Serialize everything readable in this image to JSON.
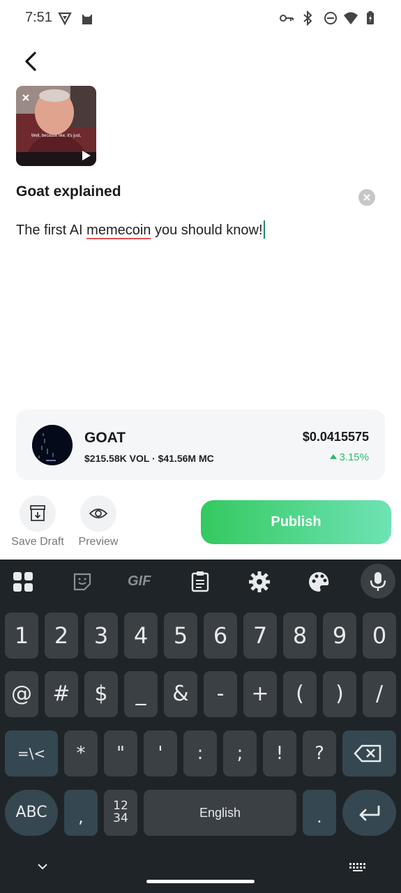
{
  "status_bar": {
    "time": "7:51",
    "icons": [
      "vpn-shield-icon",
      "cat-notification-icon",
      "key-icon",
      "bluetooth-icon",
      "do-not-disturb-icon",
      "wifi-icon",
      "battery-charging-icon"
    ]
  },
  "header": {
    "back_icon": "chevron-left-icon"
  },
  "media": {
    "caption": "Well, because like, it's just,",
    "remove_icon": "close-icon",
    "type_icon": "play-icon"
  },
  "post": {
    "title": "Goat explained",
    "body_before": "The first AI ",
    "body_misspelled": "memecoin",
    "body_after": " you should know!"
  },
  "token": {
    "name": "GOAT",
    "stats": "$215.58K VOL · $41.56M MC",
    "price": "$0.0415575",
    "change": "3.15%",
    "change_color": "#2fb86b"
  },
  "actions": {
    "save_draft": "Save Draft",
    "preview": "Preview",
    "publish": "Publish"
  },
  "keyboard": {
    "toolbar_icons": [
      "apps-grid-icon",
      "sticker-icon",
      "gif-icon",
      "clipboard-icon",
      "settings-gear-icon",
      "palette-icon",
      "microphone-icon"
    ],
    "gif_label": "GIF",
    "row1": [
      "1",
      "2",
      "3",
      "4",
      "5",
      "6",
      "7",
      "8",
      "9",
      "0"
    ],
    "row2": [
      "@",
      "#",
      "$",
      "_",
      "&",
      "-",
      "+",
      "(",
      ")",
      "/"
    ],
    "row3": [
      "=\\<",
      "*",
      "\"",
      "'",
      ":",
      ";",
      "!",
      "?"
    ],
    "abc": "ABC",
    "comma": ",",
    "numpad_top": "12",
    "numpad_bottom": "34",
    "space": "English",
    "period": "."
  },
  "nav_bar": {
    "icons": [
      "chevron-down-icon",
      "keyboard-icon"
    ]
  }
}
